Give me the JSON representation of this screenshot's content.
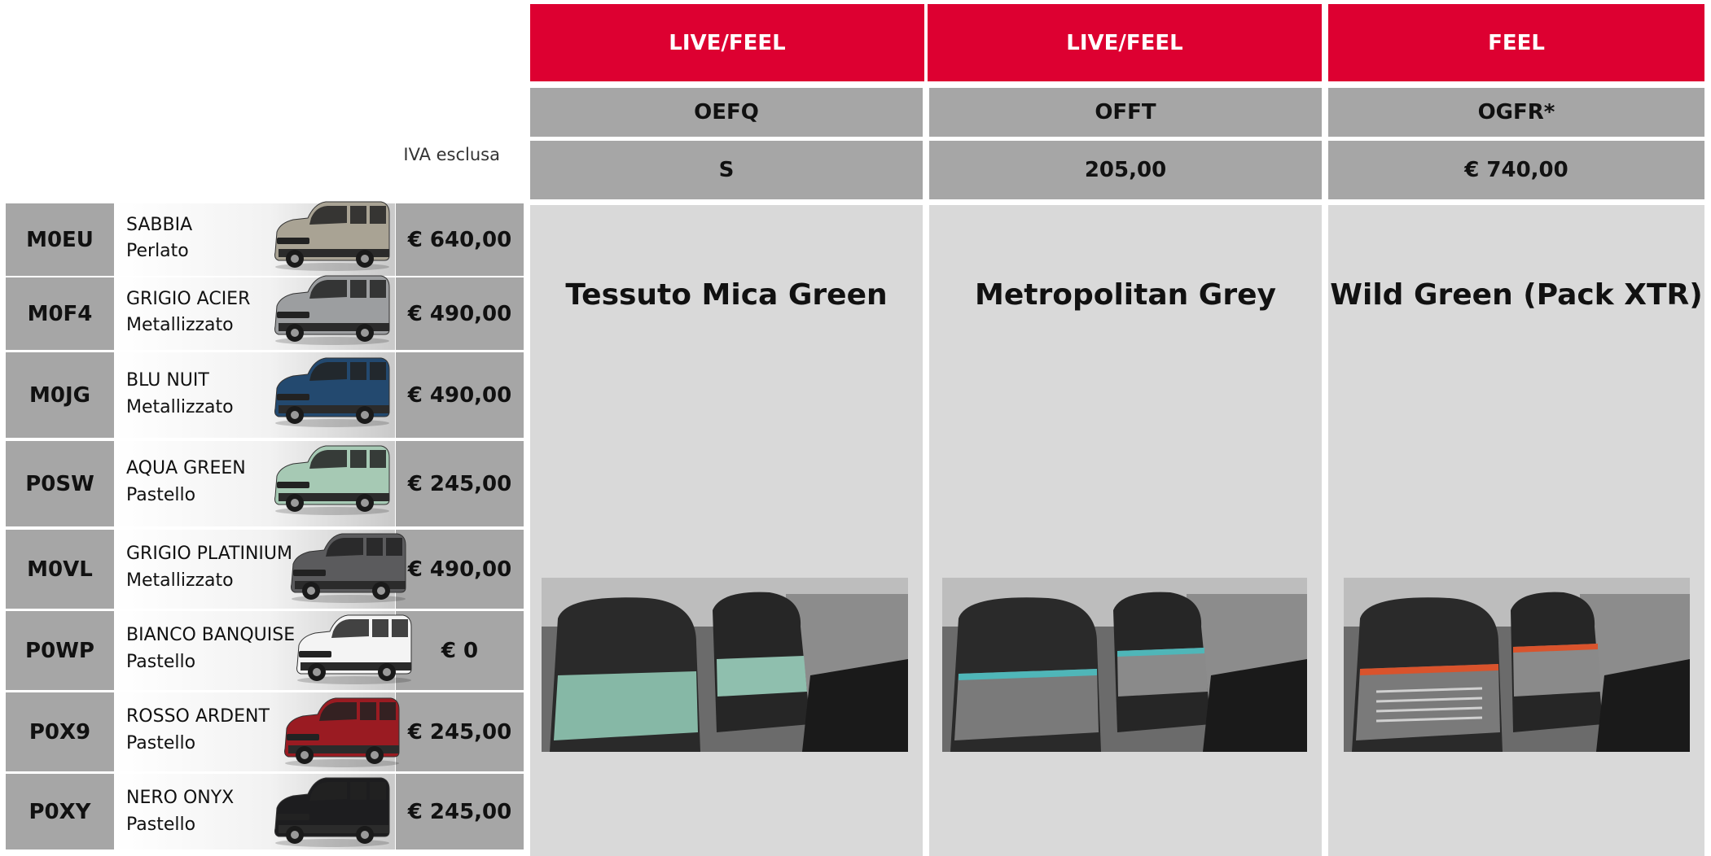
{
  "header": {
    "columns": [
      {
        "label": "LIVE/FEEL",
        "code": "OEFQ",
        "price": "S",
        "title": "Tessuto Mica Green"
      },
      {
        "label": "LIVE/FEEL",
        "code": "OFFT",
        "price": "205,00",
        "title": "Metropolitan Grey"
      },
      {
        "label": "FEEL",
        "code": "OGFR*",
        "price": "€ 740,00",
        "title": "Wild Green (Pack XTR)"
      }
    ],
    "vat_note": "IVA esclusa"
  },
  "colors": [
    {
      "code": "M0EU",
      "name": "SABBIA",
      "finish": "Perlato",
      "price": "€ 640,00",
      "car_color": "#a9a394"
    },
    {
      "code": "M0F4",
      "name": "GRIGIO ACIER",
      "finish": "Metallizzato",
      "price": "€ 490,00",
      "car_color": "#9c9ea0"
    },
    {
      "code": "M0JG",
      "name": "BLU NUIT",
      "finish": "Metallizzato",
      "price": "€ 490,00",
      "car_color": "#23496f"
    },
    {
      "code": "P0SW",
      "name": "AQUA GREEN",
      "finish": "Pastello",
      "price": "€ 245,00",
      "car_color": "#a6c9b4"
    },
    {
      "code": "M0VL",
      "name": "GRIGIO PLATINIUM",
      "finish": "Metallizzato",
      "price": "€ 490,00",
      "car_color": "#5b5b5d"
    },
    {
      "code": "P0WP",
      "name": "BIANCO BANQUISE",
      "finish": "Pastello",
      "price": "€ 0",
      "car_color": "#f4f4f4"
    },
    {
      "code": "P0X9",
      "name": "ROSSO ARDENT",
      "finish": "Pastello",
      "price": "€ 245,00",
      "car_color": "#9a1b22"
    },
    {
      "code": "P0XY",
      "name": "NERO ONYX",
      "finish": "Pastello",
      "price": "€ 245,00",
      "car_color": "#1d1d1f"
    }
  ],
  "theme": {
    "accent_red": "#dd0031",
    "header_grey": "#a6a6a6",
    "panel_grey": "#d9d9d9"
  }
}
